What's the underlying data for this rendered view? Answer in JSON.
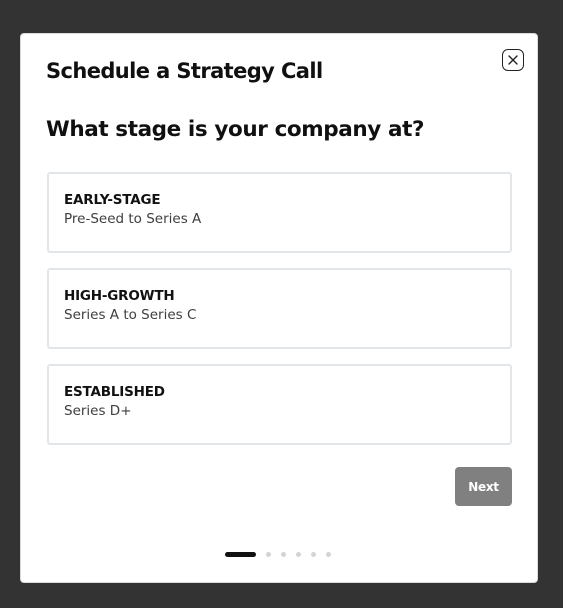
{
  "modal": {
    "title": "Schedule a Strategy Call",
    "question": "What stage is your company at?",
    "close_icon": "close-icon"
  },
  "options": [
    {
      "title": "EARLY-STAGE",
      "subtitle": "Pre-Seed to Series A"
    },
    {
      "title": "HIGH-GROWTH",
      "subtitle": "Series A to Series C"
    },
    {
      "title": "ESTABLISHED",
      "subtitle": "Series D+"
    }
  ],
  "next_button": {
    "label": "Next",
    "color": "#808080"
  },
  "progress": {
    "current_step": 1,
    "total_steps": 6
  },
  "colors": {
    "background": "#333333",
    "modal_bg": "#ffffff",
    "option_border": "#e3e6e9",
    "active_dot": "#111111",
    "inactive_dot": "#d4d4d4"
  }
}
